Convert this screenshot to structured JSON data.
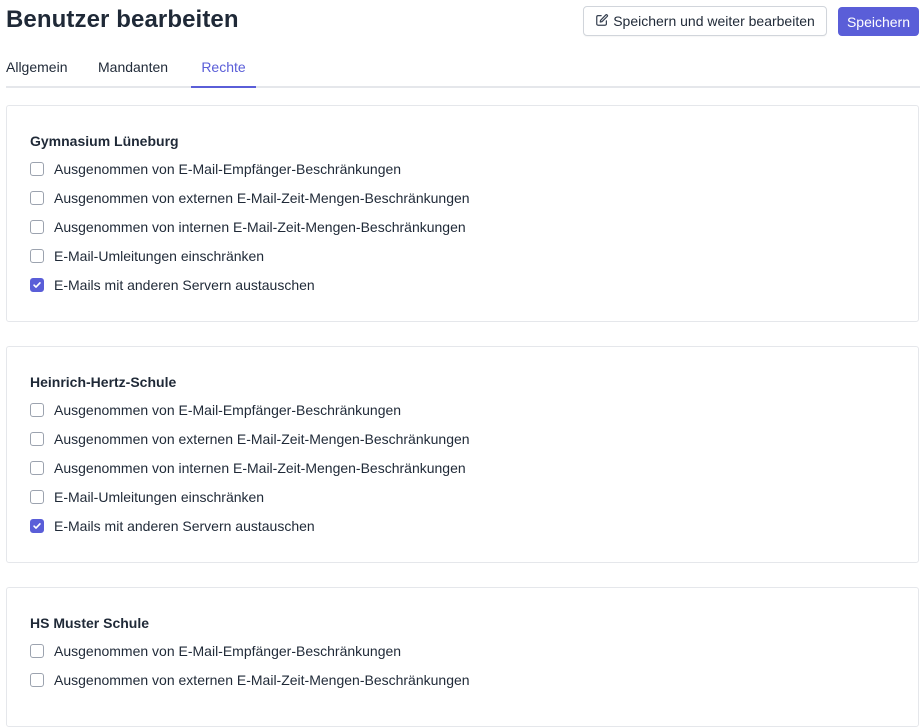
{
  "header": {
    "title": "Benutzer bearbeiten",
    "save_continue_label": "Speichern und weiter bearbeiten",
    "save_label": "Speichern"
  },
  "tabs": [
    {
      "label": "Allgemein",
      "active": false
    },
    {
      "label": "Mandanten",
      "active": false
    },
    {
      "label": "Rechte",
      "active": true
    }
  ],
  "groups": [
    {
      "name": "Gymnasium Lüneburg",
      "options": [
        {
          "label": "Ausgenommen von E-Mail-Empfänger-Beschränkungen",
          "checked": false
        },
        {
          "label": "Ausgenommen von externen E-Mail-Zeit-Mengen-Beschränkungen",
          "checked": false
        },
        {
          "label": "Ausgenommen von internen E-Mail-Zeit-Mengen-Beschränkungen",
          "checked": false
        },
        {
          "label": "E-Mail-Umleitungen einschränken",
          "checked": false
        },
        {
          "label": "E-Mails mit anderen Servern austauschen",
          "checked": true
        }
      ]
    },
    {
      "name": "Heinrich-Hertz-Schule",
      "options": [
        {
          "label": "Ausgenommen von E-Mail-Empfänger-Beschränkungen",
          "checked": false
        },
        {
          "label": "Ausgenommen von externen E-Mail-Zeit-Mengen-Beschränkungen",
          "checked": false
        },
        {
          "label": "Ausgenommen von internen E-Mail-Zeit-Mengen-Beschränkungen",
          "checked": false
        },
        {
          "label": "E-Mail-Umleitungen einschränken",
          "checked": false
        },
        {
          "label": "E-Mails mit anderen Servern austauschen",
          "checked": true
        }
      ]
    },
    {
      "name": "HS Muster Schule",
      "options": [
        {
          "label": "Ausgenommen von E-Mail-Empfänger-Beschränkungen",
          "checked": false
        },
        {
          "label": "Ausgenommen von externen E-Mail-Zeit-Mengen-Beschränkungen",
          "checked": false
        }
      ]
    }
  ],
  "colors": {
    "accent": "#5a5ed8",
    "border": "#e5e7eb",
    "text": "#1f2937"
  },
  "icons": {
    "edit": "pencil-square-icon",
    "check": "checkmark-icon"
  }
}
